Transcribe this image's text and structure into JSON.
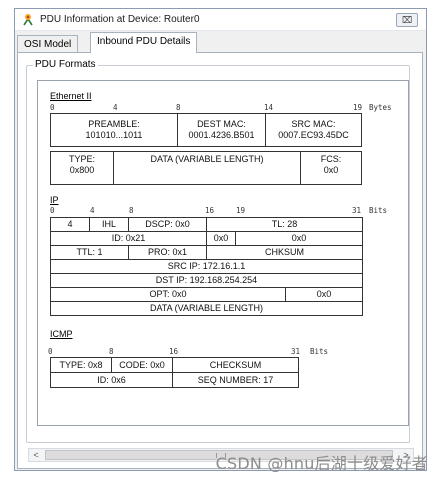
{
  "window": {
    "title": "PDU Information at Device: Router0",
    "close_label": "⌧"
  },
  "tabs": [
    "OSI Model",
    "Inbound PDU Details"
  ],
  "group_title": "PDU Formats",
  "ethernet": {
    "title": "Ethernet II",
    "ruler": [
      "0",
      "4",
      "8",
      "14",
      "19",
      "Bytes"
    ],
    "preamble_label": "PREAMBLE:",
    "preamble_value": "101010...1011",
    "dest_label": "DEST MAC:",
    "dest_value": "0001.4236.B501",
    "src_label": "SRC MAC:",
    "src_value": "0007.EC93.45DC",
    "type_label": "TYPE:",
    "type_value": "0x800",
    "data_label": "DATA (VARIABLE LENGTH)",
    "fcs_label": "FCS:",
    "fcs_value": "0x0"
  },
  "ip": {
    "title": "IP",
    "ruler": [
      "0",
      "4",
      "8",
      "16",
      "19",
      "31",
      "Bits"
    ],
    "version": "4",
    "ihl": "IHL",
    "dscp": "DSCP: 0x0",
    "tl": "TL: 28",
    "id": "ID: 0x21",
    "flags": "0x0",
    "frag": "0x0",
    "ttl": "TTL: 1",
    "pro": "PRO: 0x1",
    "chksum": "CHKSUM",
    "src_ip": "SRC IP: 172.16.1.1",
    "dst_ip": "DST IP: 192.168.254.254",
    "opt": "OPT: 0x0",
    "pad": "0x0",
    "data": "DATA (VARIABLE LENGTH)"
  },
  "icmp": {
    "title": "ICMP",
    "ruler": [
      "0",
      "8",
      "16",
      "31",
      "Bits"
    ],
    "type": "TYPE: 0x8",
    "code": "CODE: 0x0",
    "chksum": "CHECKSUM",
    "id": "ID: 0x6",
    "seq": "SEQ NUMBER: 17"
  },
  "scrollbar": {
    "left_arrow": "<",
    "right_arrow": ">"
  },
  "watermark": "CSDN @hnu后湖十级爱好者"
}
